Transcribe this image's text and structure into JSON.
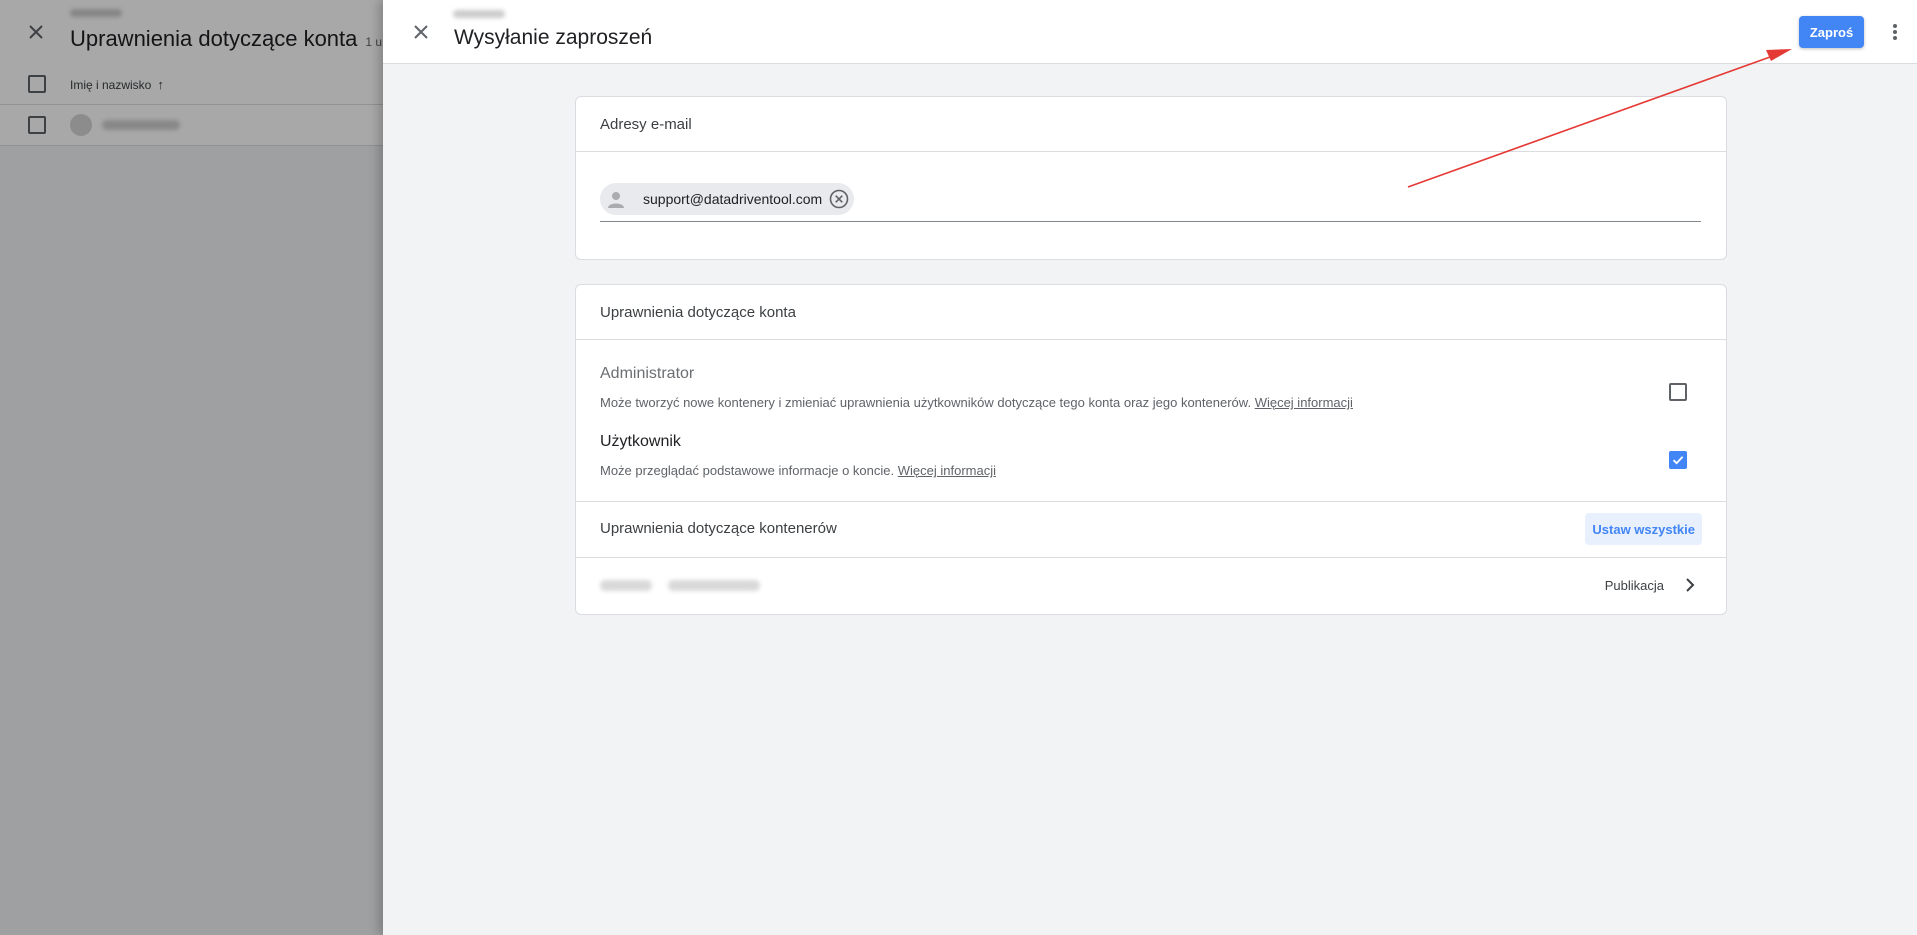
{
  "background": {
    "title": "Uprawnienia dotyczące konta",
    "title_suffix": "1 u",
    "column_header": "Imię i nazwisko",
    "sort_icon": "arrow-up-icon"
  },
  "dialog": {
    "title": "Wysyłanie zaproszeń",
    "invite_label": "Zaproś",
    "email_card": {
      "heading": "Adresy e-mail",
      "chips": [
        "support@datadriventool.com"
      ]
    },
    "permissions_card": {
      "heading": "Uprawnienia dotyczące konta",
      "admin": {
        "title": "Administrator",
        "description": "Może tworzyć nowe kontenery i zmieniać uprawnienia użytkowników dotyczące tego konta oraz jego kontenerów.",
        "link": "Więcej informacji",
        "checked": false
      },
      "user": {
        "title": "Użytkownik",
        "description": "Może przeglądać podstawowe informacje o koncie.",
        "link": "Więcej informacji",
        "checked": true
      },
      "containers_heading": "Uprawnienia dotyczące kontenerów",
      "set_all_label": "Ustaw wszystkie",
      "container_role": "Publikacja"
    }
  },
  "colors": {
    "primary": "#4285f4",
    "primary_light": "#e8f0fe",
    "annotation_arrow": "#e53935"
  }
}
